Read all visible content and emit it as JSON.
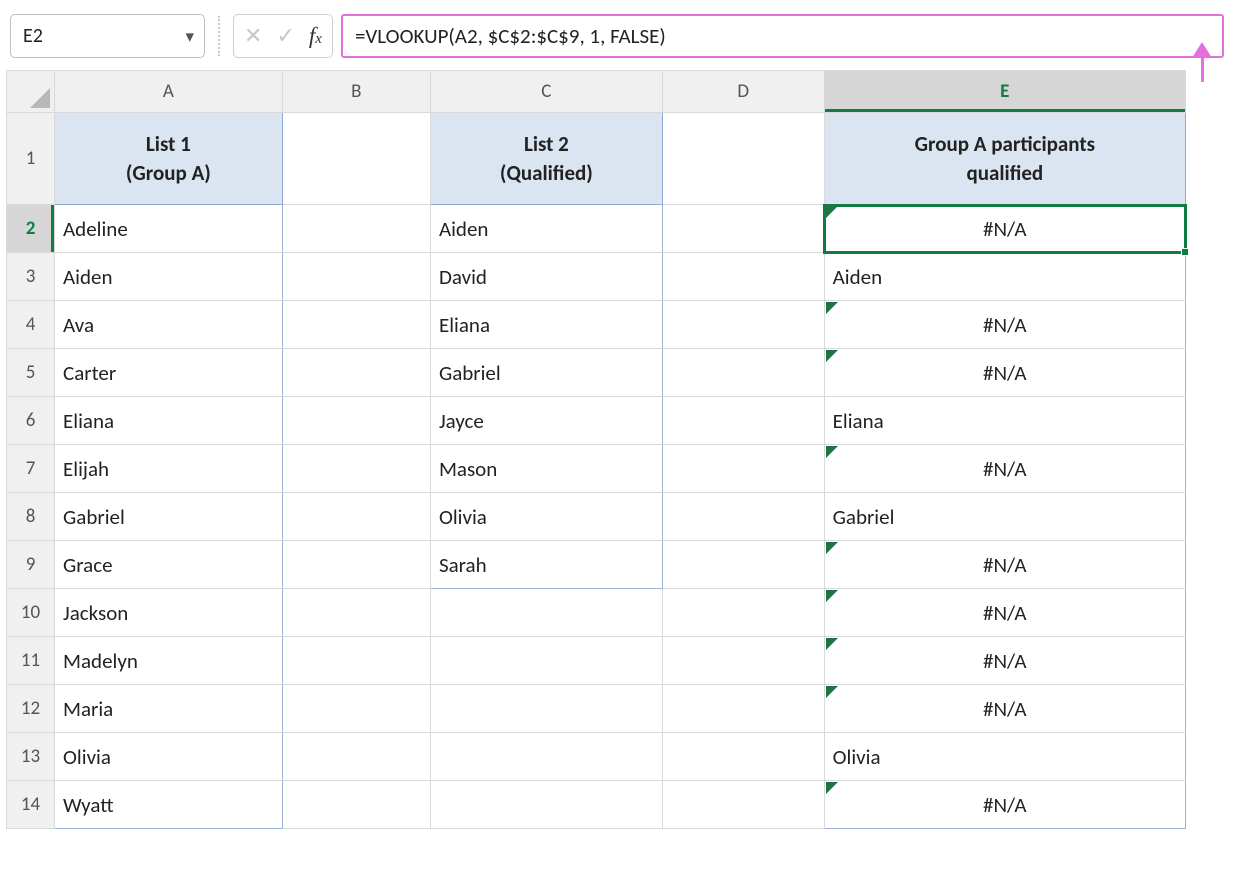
{
  "namebox": "E2",
  "formula": "=VLOOKUP(A2, $C$2:$C$9, 1, FALSE)",
  "columns": [
    "A",
    "B",
    "C",
    "D",
    "E"
  ],
  "headers": {
    "A": "List 1\n(Group A)",
    "C": "List 2\n(Qualified)",
    "E": "Group A participants\nqualified"
  },
  "row_count": 14,
  "selected_cell": "E2",
  "colA": [
    "Adeline",
    "Aiden",
    "Ava",
    "Carter",
    "Eliana",
    "Elijah",
    "Gabriel",
    "Grace",
    "Jackson",
    "Madelyn",
    "Maria",
    "Olivia",
    "Wyatt"
  ],
  "colC": [
    "Aiden",
    "David",
    "Eliana",
    "Gabriel",
    "Jayce",
    "Mason",
    "Olivia",
    "Sarah"
  ],
  "colE": [
    {
      "text": "#N/A",
      "err": true,
      "center": true
    },
    {
      "text": "Aiden",
      "err": false,
      "center": false
    },
    {
      "text": "#N/A",
      "err": true,
      "center": true
    },
    {
      "text": "#N/A",
      "err": true,
      "center": true
    },
    {
      "text": "Eliana",
      "err": false,
      "center": false
    },
    {
      "text": "#N/A",
      "err": true,
      "center": true
    },
    {
      "text": "Gabriel",
      "err": false,
      "center": false
    },
    {
      "text": "#N/A",
      "err": true,
      "center": true
    },
    {
      "text": "#N/A",
      "err": true,
      "center": true
    },
    {
      "text": "#N/A",
      "err": true,
      "center": true
    },
    {
      "text": "#N/A",
      "err": true,
      "center": true
    },
    {
      "text": "Olivia",
      "err": false,
      "center": false
    },
    {
      "text": "#N/A",
      "err": true,
      "center": true
    }
  ]
}
